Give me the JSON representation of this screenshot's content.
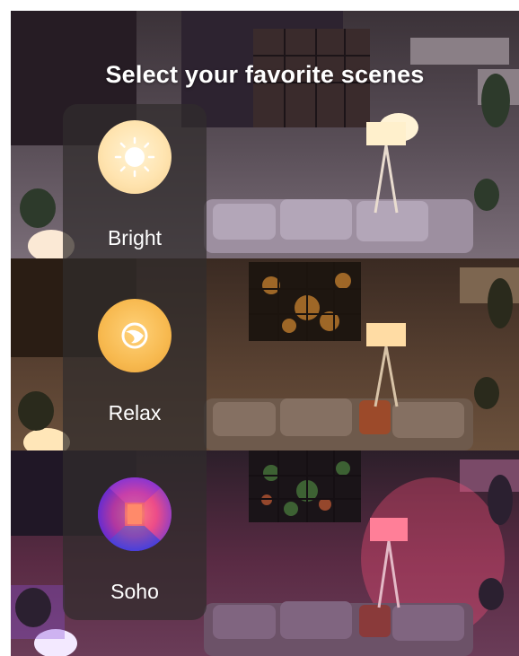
{
  "page": {
    "title": "Select your favorite scenes"
  },
  "scenes": [
    {
      "label": "Bright",
      "icon": "sun-icon",
      "color": "#ffe4b0"
    },
    {
      "label": "Relax",
      "icon": "relax-icon",
      "color": "#f7b94f"
    },
    {
      "label": "Soho",
      "icon": "soho-icon",
      "color": "#d23a9a"
    }
  ]
}
